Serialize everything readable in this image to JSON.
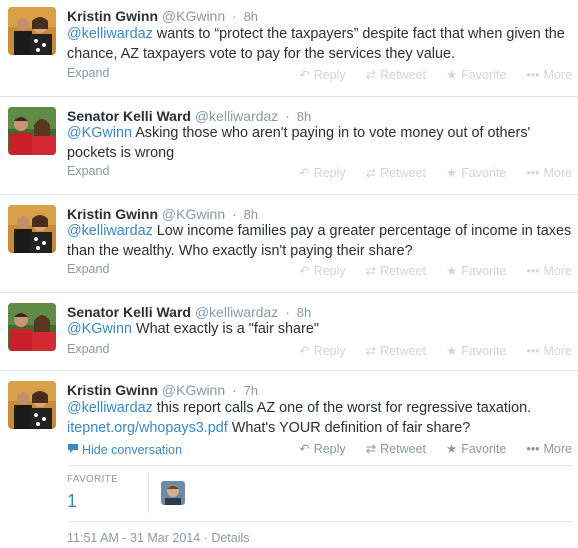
{
  "tweets": [
    {
      "fullname": "Kristin Gwinn",
      "screenname": "@KGwinn",
      "time": "8h",
      "mention": "@kelliwardaz",
      "text_line1_rest": " wants to “protect the taxpayers” despite fact that when given the",
      "text_line2": "chance, AZ taxpayers vote to pay for the services they value.",
      "expand": "Expand"
    },
    {
      "fullname": "Senator Kelli Ward",
      "screenname": "@kelliwardaz",
      "time": "8h",
      "mention": "@KGwinn",
      "text_line1_rest": " Asking those who aren't paying in to vote money out of others'",
      "text_line2": "pockets is wrong",
      "expand": "Expand"
    },
    {
      "fullname": "Kristin Gwinn",
      "screenname": "@KGwinn",
      "time": "8h",
      "mention": "@kelliwardaz",
      "text_line1_rest": "  Low income families pay a greater percentage of income in taxes",
      "text_line2": "than the wealthy. Who exactly isn't paying their share?",
      "expand": "Expand"
    },
    {
      "fullname": "Senator Kelli Ward",
      "screenname": "@kelliwardaz",
      "time": "8h",
      "mention": "@KGwinn",
      "text_line1_rest": " What exactly is a \"fair share\"",
      "expand": "Expand"
    },
    {
      "fullname": "Kristin Gwinn",
      "screenname": "@KGwinn",
      "time": "7h",
      "mention": "@kelliwardaz",
      "text_line1_rest": " this report calls AZ one of the worst for regressive taxation.",
      "link": "itepnet.org/whopays3.pdf",
      "text_line2_rest": "   What's YOUR definition of fair share?",
      "hide_conversation": "Hide conversation"
    }
  ],
  "actions": {
    "reply": "Reply",
    "retweet": "Retweet",
    "favorite": "Favorite",
    "more": "More"
  },
  "icons": {
    "reply": "reply-arrow-icon",
    "retweet": "retweet-icon",
    "favorite": "star-icon",
    "more": "more-dots-icon",
    "conversation": "speech-bubble-icon"
  },
  "stats": {
    "favorite_label": "FAVORITE",
    "favorite_count": "1"
  },
  "footer": {
    "timestamp": "11:51 AM - 31 Mar 2014",
    "separator": "·",
    "details": "Details"
  },
  "colors": {
    "link": "#3b88c3",
    "muted": "#8899a6",
    "text": "#292f33",
    "divider": "#e1e8ed"
  }
}
